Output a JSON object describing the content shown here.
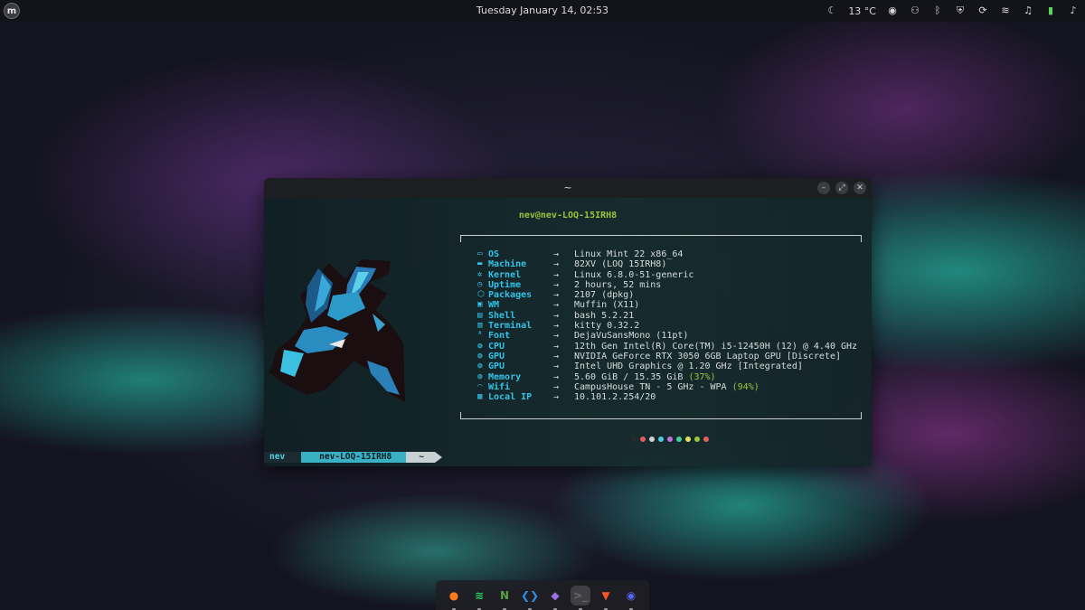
{
  "topbar": {
    "clock": "Tuesday January 14, 02:53",
    "weather": "13 °C",
    "tray_icons": [
      "moon-icon",
      "discord-icon",
      "network-icon",
      "bluetooth-icon",
      "shield-icon",
      "sync-icon",
      "wifi-icon",
      "music-icon",
      "battery-icon",
      "bell-icon"
    ]
  },
  "terminal": {
    "title": "~",
    "userhost": "nev@nev-LOQ-15IRH8",
    "arrow": "→",
    "rows": [
      {
        "icon": "monitor-icon",
        "key": "OS",
        "value": "Linux Mint 22 x86_64"
      },
      {
        "icon": "laptop-icon",
        "key": "Machine",
        "value": "82XV (LOQ 15IRH8)"
      },
      {
        "icon": "gear-icon",
        "key": "Kernel",
        "value": "Linux 6.8.0-51-generic"
      },
      {
        "icon": "clock-icon",
        "key": "Uptime",
        "value": "2 hours, 52 mins"
      },
      {
        "icon": "package-icon",
        "key": "Packages",
        "value": "2107 (dpkg)"
      },
      {
        "icon": "window-icon",
        "key": "WM",
        "value": "Muffin (X11)"
      },
      {
        "icon": "shell-icon",
        "key": "Shell",
        "value": "bash 5.2.21"
      },
      {
        "icon": "terminal-icon",
        "key": "Terminal",
        "value": "kitty 0.32.2"
      },
      {
        "icon": "font-icon",
        "key": "Font",
        "value": "DejaVuSansMono (11pt)"
      },
      {
        "icon": "chip-icon",
        "key": "CPU",
        "value": "12th Gen Intel(R) Core(TM) i5-12450H (12) @ 4.40 GHz"
      },
      {
        "icon": "chip-icon",
        "key": "GPU",
        "value": "NVIDIA GeForce RTX 3050 6GB Laptop GPU [Discrete]"
      },
      {
        "icon": "chip-icon",
        "key": "GPU",
        "value": "Intel UHD Graphics @ 1.20 GHz [Integrated]"
      },
      {
        "icon": "memory-icon",
        "key": "Memory",
        "value": "5.60 GiB / 15.35 GiB",
        "pct": "(37%)"
      },
      {
        "icon": "wifi-icon",
        "key": "Wifi",
        "value": "CampusHouse TN - 5 GHz - WPA",
        "pct": "(94%)"
      },
      {
        "icon": "ip-icon",
        "key": "Local IP",
        "value": "10.101.2.254/20"
      }
    ],
    "palette": [
      "#2a2a2a",
      "#e05a5a",
      "#d0d0d0",
      "#4fc8e8",
      "#c070e0",
      "#40d0a0",
      "#e0e060",
      "#9dc43a",
      "#e06060"
    ],
    "prompt": {
      "user": "nev",
      "host": "nev-LOQ-15IRH8",
      "dir": "~"
    }
  },
  "dock": {
    "apps": [
      {
        "name": "firefox-icon",
        "glyph": "●",
        "color": "#ff7a1a",
        "active": false
      },
      {
        "name": "spotify-icon",
        "glyph": "≋",
        "color": "#1ed760",
        "active": false
      },
      {
        "name": "neovim-icon",
        "glyph": "N",
        "color": "#57a143",
        "active": false
      },
      {
        "name": "vscode-icon",
        "glyph": "❮❯",
        "color": "#2e8ee0",
        "active": false
      },
      {
        "name": "obsidian-icon",
        "glyph": "◆",
        "color": "#9a6fe0",
        "active": false
      },
      {
        "name": "terminal-icon",
        "glyph": ">_",
        "color": "#6a6a6a",
        "active": true
      },
      {
        "name": "brave-icon",
        "glyph": "▼",
        "color": "#fb542b",
        "active": false
      },
      {
        "name": "discord-icon",
        "glyph": "◉",
        "color": "#5865f2",
        "active": false
      }
    ]
  }
}
